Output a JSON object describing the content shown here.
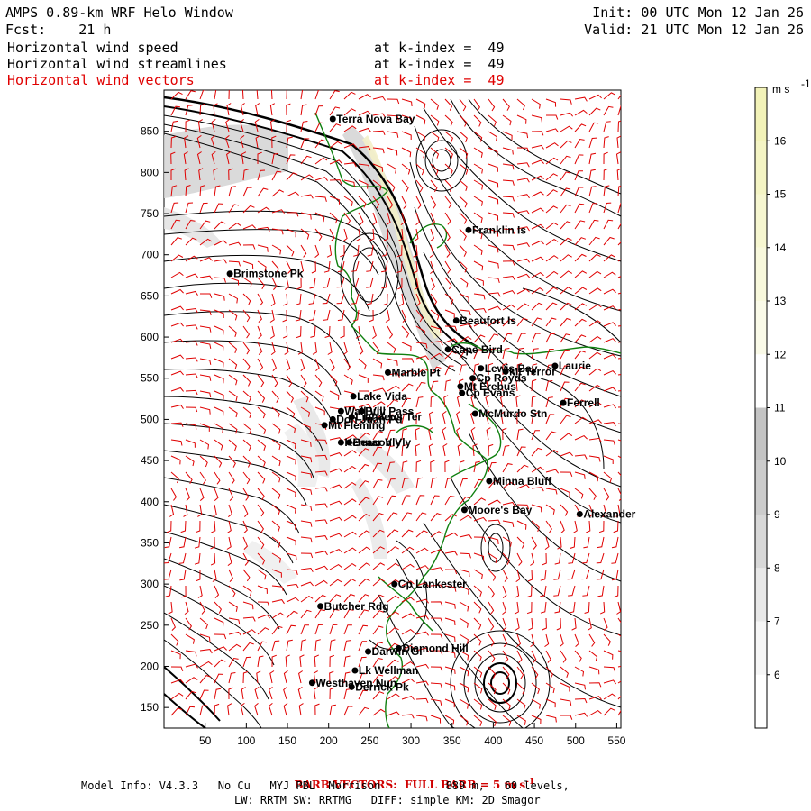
{
  "header": {
    "title": "AMPS 0.89-km WRF Helo Window",
    "forecast": "Fcst:    21 h",
    "init": "Init: 00 UTC Mon 12 Jan 26",
    "valid": "Valid: 21 UTC Mon 12 Jan 26",
    "fields": [
      {
        "name": "Horizontal wind speed",
        "level": "at k-index =  49",
        "color": "#000000"
      },
      {
        "name": "Horizontal wind streamlines",
        "level": "at k-index =  49",
        "color": "#000000"
      },
      {
        "name": "Horizontal wind vectors",
        "level": "at k-index =  49",
        "color": "#e00000"
      }
    ]
  },
  "colorbar": {
    "unit": "m s",
    "unit_exp": "-1",
    "ticks": [
      "6",
      "7",
      "8",
      "9",
      "10",
      "11",
      "12",
      "13",
      "14",
      "15",
      "16"
    ],
    "bands": [
      "#ffffff",
      "#f6f6f6",
      "#e8e8e8",
      "#d8d8d8",
      "#cccccc",
      "#c4c4c4",
      "#ffffff",
      "#fafae8",
      "#f8f8dc",
      "#f6f6d0",
      "#f4f4c4",
      "#f2f2b8"
    ]
  },
  "axes": {
    "x_ticks": [
      "50",
      "100",
      "150",
      "200",
      "250",
      "300",
      "350",
      "400",
      "450",
      "500",
      "550"
    ],
    "y_ticks": [
      "850",
      "800",
      "750",
      "700",
      "650",
      "600",
      "550",
      "500",
      "450",
      "400",
      "350",
      "300",
      "250",
      "200",
      "150"
    ]
  },
  "sites": [
    {
      "name": "Terra Nova Bay",
      "x": 205,
      "y": 865
    },
    {
      "name": "Franklin Is",
      "x": 370,
      "y": 730
    },
    {
      "name": "Brimstone Pk",
      "x": 80,
      "y": 677
    },
    {
      "name": "Beaufort Is",
      "x": 355,
      "y": 620
    },
    {
      "name": "Cape Bird",
      "x": 345,
      "y": 585
    },
    {
      "name": "Lewis Bay",
      "x": 385,
      "y": 562
    },
    {
      "name": "Laurie",
      "x": 475,
      "y": 565
    },
    {
      "name": "Mt Terror",
      "x": 415,
      "y": 558
    },
    {
      "name": "Marble Pt",
      "x": 272,
      "y": 557
    },
    {
      "name": "Cp Royds",
      "x": 375,
      "y": 550
    },
    {
      "name": "Mt Erebus",
      "x": 360,
      "y": 540
    },
    {
      "name": "Cp Evans",
      "x": 362,
      "y": 532
    },
    {
      "name": "Lake Vida",
      "x": 230,
      "y": 528
    },
    {
      "name": "Ferrell",
      "x": 485,
      "y": 520
    },
    {
      "name": "Wall Vly",
      "x": 215,
      "y": 510
    },
    {
      "name": "McMurdo Stn",
      "x": 378,
      "y": 507
    },
    {
      "name": "Bull Pass",
      "x": 240,
      "y": 510
    },
    {
      "name": "Don Juan Pd",
      "x": 205,
      "y": 500
    },
    {
      "name": "Mt Fleming",
      "x": 195,
      "y": 493
    },
    {
      "name": "Linnaeus Ter",
      "x": 228,
      "y": 503
    },
    {
      "name": "Kennar Vly",
      "x": 215,
      "y": 472
    },
    {
      "name": "Beacon Vly",
      "x": 225,
      "y": 472
    },
    {
      "name": "Minna Bluff",
      "x": 395,
      "y": 425
    },
    {
      "name": "Moore's Bay",
      "x": 365,
      "y": 390
    },
    {
      "name": "Alexander",
      "x": 505,
      "y": 385
    },
    {
      "name": "Cp Lankester",
      "x": 280,
      "y": 300
    },
    {
      "name": "Butcher Rdg",
      "x": 190,
      "y": 273
    },
    {
      "name": "Darwin Gl",
      "x": 248,
      "y": 218
    },
    {
      "name": "Diamond Hill",
      "x": 285,
      "y": 222
    },
    {
      "name": "Lk Wellman",
      "x": 232,
      "y": 195
    },
    {
      "name": "Westhaven Nun",
      "x": 180,
      "y": 180
    },
    {
      "name": "Derrick Pk",
      "x": 228,
      "y": 175
    }
  ],
  "footer": {
    "barb_note": "BARB VECTORS:  FULL BARB = 5 m s",
    "barb_exp": "-1",
    "model_info": "Model Info: V4.3.3   No Cu   MYJ PBL  Morrison          889 m,   60 levels,",
    "physics": "LW: RRTM SW: RRTMG   DIFF: simple KM: 2D Smagor"
  }
}
